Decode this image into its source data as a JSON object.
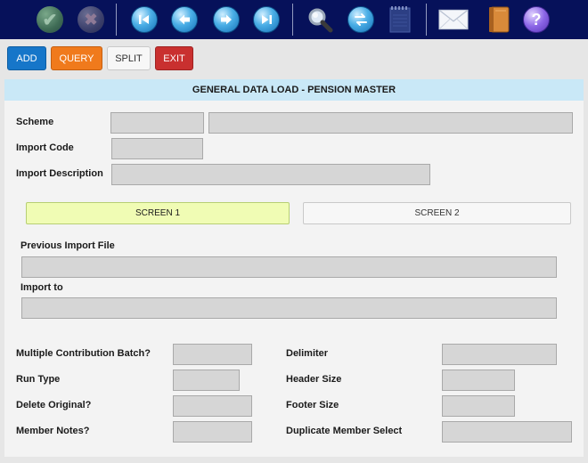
{
  "toolbar": {
    "icons": [
      {
        "name": "confirm-icon",
        "glyph": "✔"
      },
      {
        "name": "cancel-icon",
        "glyph": "✖"
      },
      {
        "name": "first-record-icon",
        "glyph": "⏮"
      },
      {
        "name": "previous-record-icon",
        "glyph": "⇦"
      },
      {
        "name": "next-record-icon",
        "glyph": "⇨"
      },
      {
        "name": "last-record-icon",
        "glyph": "⏭"
      },
      {
        "name": "search-icon",
        "glyph": "🔍"
      },
      {
        "name": "refresh-icon",
        "glyph": "⇄"
      },
      {
        "name": "notepad-icon",
        "glyph": ""
      },
      {
        "name": "mail-icon",
        "glyph": ""
      },
      {
        "name": "book-icon",
        "glyph": ""
      },
      {
        "name": "help-icon",
        "glyph": "?"
      }
    ]
  },
  "actions": {
    "add": "ADD",
    "query": "QUERY",
    "split": "SPLIT",
    "exit": "EXIT"
  },
  "form": {
    "title": "GENERAL DATA LOAD - PENSION MASTER",
    "scheme_label": "Scheme",
    "scheme_code": "",
    "scheme_name": "",
    "import_code_label": "Import Code",
    "import_code": "",
    "import_description_label": "Import Description",
    "import_description": "",
    "tabs": [
      "SCREEN 1",
      "SCREEN 2"
    ],
    "previous_import_file_label": "Previous Import File",
    "previous_import_file": "",
    "import_to_label": "Import to",
    "import_to": "",
    "left_fields": [
      {
        "label": "Multiple Contribution Batch?",
        "value": ""
      },
      {
        "label": "Run Type",
        "value": ""
      },
      {
        "label": "Delete Original?",
        "value": ""
      },
      {
        "label": "Member Notes?",
        "value": ""
      }
    ],
    "right_fields": [
      {
        "label": "Delimiter",
        "value": ""
      },
      {
        "label": "Header Size",
        "value": ""
      },
      {
        "label": "Footer Size",
        "value": ""
      },
      {
        "label": "Duplicate Member Select",
        "value": ""
      }
    ]
  },
  "colors": {
    "toolbar_bg": "#06115a",
    "add": "#1676c9",
    "query": "#f07a1c",
    "exit": "#c9302f",
    "title_bar": "#c9e8f7",
    "active_tab": "#f0fcb4"
  }
}
